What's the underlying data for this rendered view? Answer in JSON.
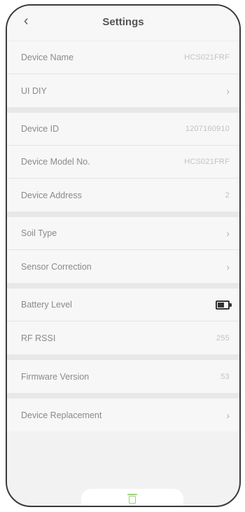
{
  "header": {
    "back_icon": "‹",
    "title": "Settings"
  },
  "section1": [
    {
      "label": "Device Name",
      "value": "HCS021FRF",
      "type": "value"
    },
    {
      "label": "UI DIY",
      "value": "",
      "type": "chevron"
    }
  ],
  "section2": [
    {
      "label": "Device ID",
      "value": "1207160910",
      "type": "value"
    },
    {
      "label": "Device Model No.",
      "value": "HCS021FRF",
      "type": "value"
    },
    {
      "label": "Device Address",
      "value": "2",
      "type": "value"
    }
  ],
  "section3": [
    {
      "label": "Soil Type",
      "value": "",
      "type": "chevron"
    },
    {
      "label": "Sensor Correction",
      "value": "",
      "type": "chevron"
    }
  ],
  "section4": [
    {
      "label": "Battery Level",
      "value": "",
      "type": "battery"
    },
    {
      "label": "RF RSSI",
      "value": "255",
      "type": "value"
    }
  ],
  "section5": [
    {
      "label": "Firmware Version",
      "value": "53",
      "type": "value"
    }
  ],
  "section6": [
    {
      "label": "Device Replacement",
      "value": "",
      "type": "chevron"
    }
  ],
  "icons": {
    "chevron": "›",
    "battery_icon": "battery-icon",
    "trash_icon": "trash-icon"
  },
  "colors": {
    "accent_green": "#9fd07a"
  }
}
